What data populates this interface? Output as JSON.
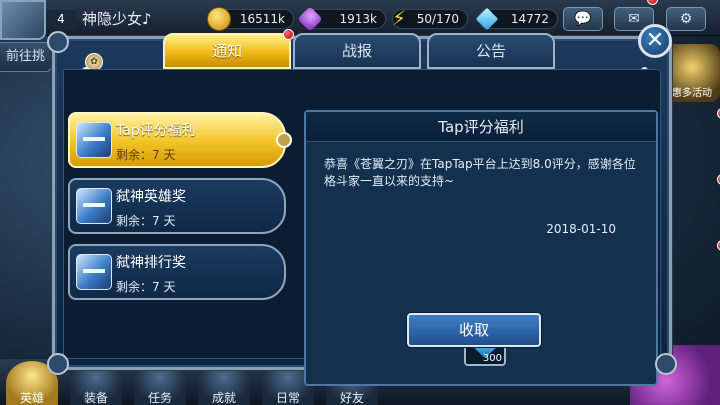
{
  "hud": {
    "level": "4",
    "player_name": "神隐少女♪",
    "gold": "16511k",
    "gems": "1913k",
    "energy": "50/170",
    "diamonds": "14772",
    "left_tab": "前往挑",
    "right_event": "惠多活动"
  },
  "bottom_nav": [
    "英雄",
    "装备",
    "任务",
    "成就",
    "日常",
    "好友"
  ],
  "dialog": {
    "tabs": [
      {
        "label": "通知",
        "active": true
      },
      {
        "label": "战报",
        "active": false
      },
      {
        "label": "公告",
        "active": false
      }
    ],
    "mails": [
      {
        "title": "Tap评分福利",
        "remain": "剩余：7 天"
      },
      {
        "title": "弑神英雄奖",
        "remain": "剩余：7 天"
      },
      {
        "title": "弑神排行奖",
        "remain": "剩余：7 天"
      }
    ],
    "detail": {
      "title": "Tap评分福利",
      "body": "恭喜《苍翼之刃》在TapTap平台上达到8.0评分，感谢各位格斗家一直以来的支持~",
      "date": "2018-01-10",
      "reward_count": "300",
      "claim_label": "收取"
    }
  }
}
